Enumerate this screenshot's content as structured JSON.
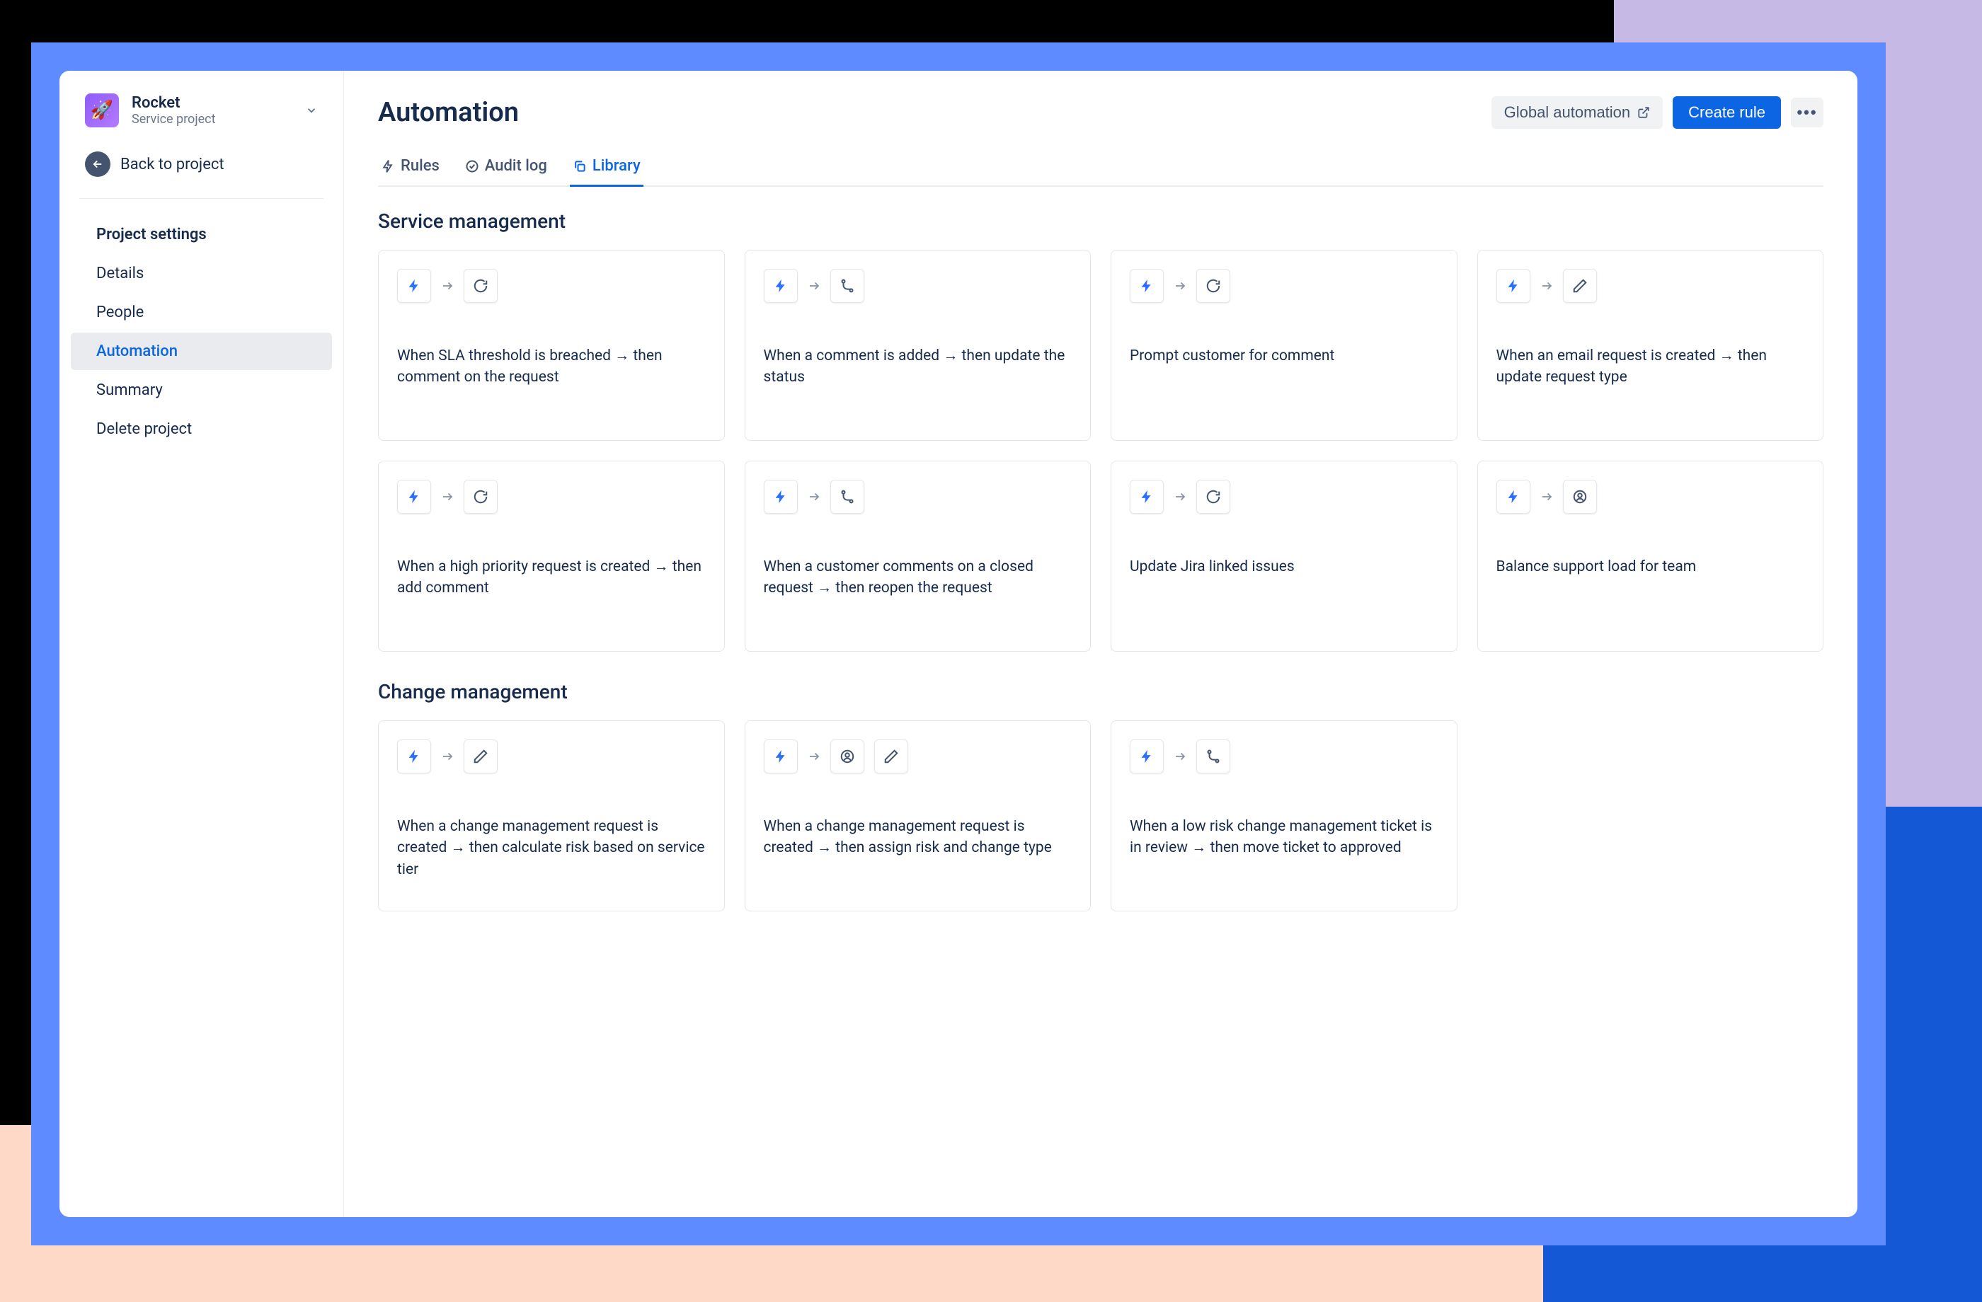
{
  "sidebar": {
    "project_name": "Rocket",
    "project_type": "Service project",
    "back_label": "Back to project",
    "nav_header": "Project settings",
    "items": [
      {
        "label": "Details",
        "active": false
      },
      {
        "label": "People",
        "active": false
      },
      {
        "label": "Automation",
        "active": true
      },
      {
        "label": "Summary",
        "active": false
      },
      {
        "label": "Delete project",
        "active": false
      }
    ]
  },
  "header": {
    "title": "Automation",
    "global_automation": "Global automation",
    "create_rule": "Create rule"
  },
  "tabs": [
    {
      "label": "Rules",
      "active": false,
      "icon": "bolt"
    },
    {
      "label": "Audit log",
      "active": false,
      "icon": "check-circle"
    },
    {
      "label": "Library",
      "active": true,
      "icon": "copy"
    }
  ],
  "sections": [
    {
      "title": "Service management",
      "cards": [
        {
          "trigger": "bolt",
          "actions": [
            "refresh"
          ],
          "description": "When SLA threshold is breached → then comment on the request"
        },
        {
          "trigger": "bolt",
          "actions": [
            "branch"
          ],
          "description": "When a comment is added → then update the status"
        },
        {
          "trigger": "bolt",
          "actions": [
            "refresh"
          ],
          "description": "Prompt customer for comment"
        },
        {
          "trigger": "bolt",
          "actions": [
            "pencil"
          ],
          "description": "When an email request is created → then update request type"
        },
        {
          "trigger": "bolt",
          "actions": [
            "refresh"
          ],
          "description": "When a high priority request is created → then add comment"
        },
        {
          "trigger": "bolt",
          "actions": [
            "branch"
          ],
          "description": "When a customer comments on a closed request → then reopen the request"
        },
        {
          "trigger": "bolt",
          "actions": [
            "refresh"
          ],
          "description": "Update Jira linked issues"
        },
        {
          "trigger": "bolt",
          "actions": [
            "person"
          ],
          "description": "Balance support load for team"
        }
      ]
    },
    {
      "title": "Change management",
      "cards": [
        {
          "trigger": "bolt",
          "actions": [
            "pencil"
          ],
          "description": "When a change management request is created → then calculate risk based on service tier"
        },
        {
          "trigger": "bolt",
          "actions": [
            "person",
            "pencil"
          ],
          "description": "When a change management request is created → then assign risk and change type"
        },
        {
          "trigger": "bolt",
          "actions": [
            "branch"
          ],
          "description": "When a low risk change management ticket is in review → then move ticket to approved"
        }
      ]
    }
  ]
}
